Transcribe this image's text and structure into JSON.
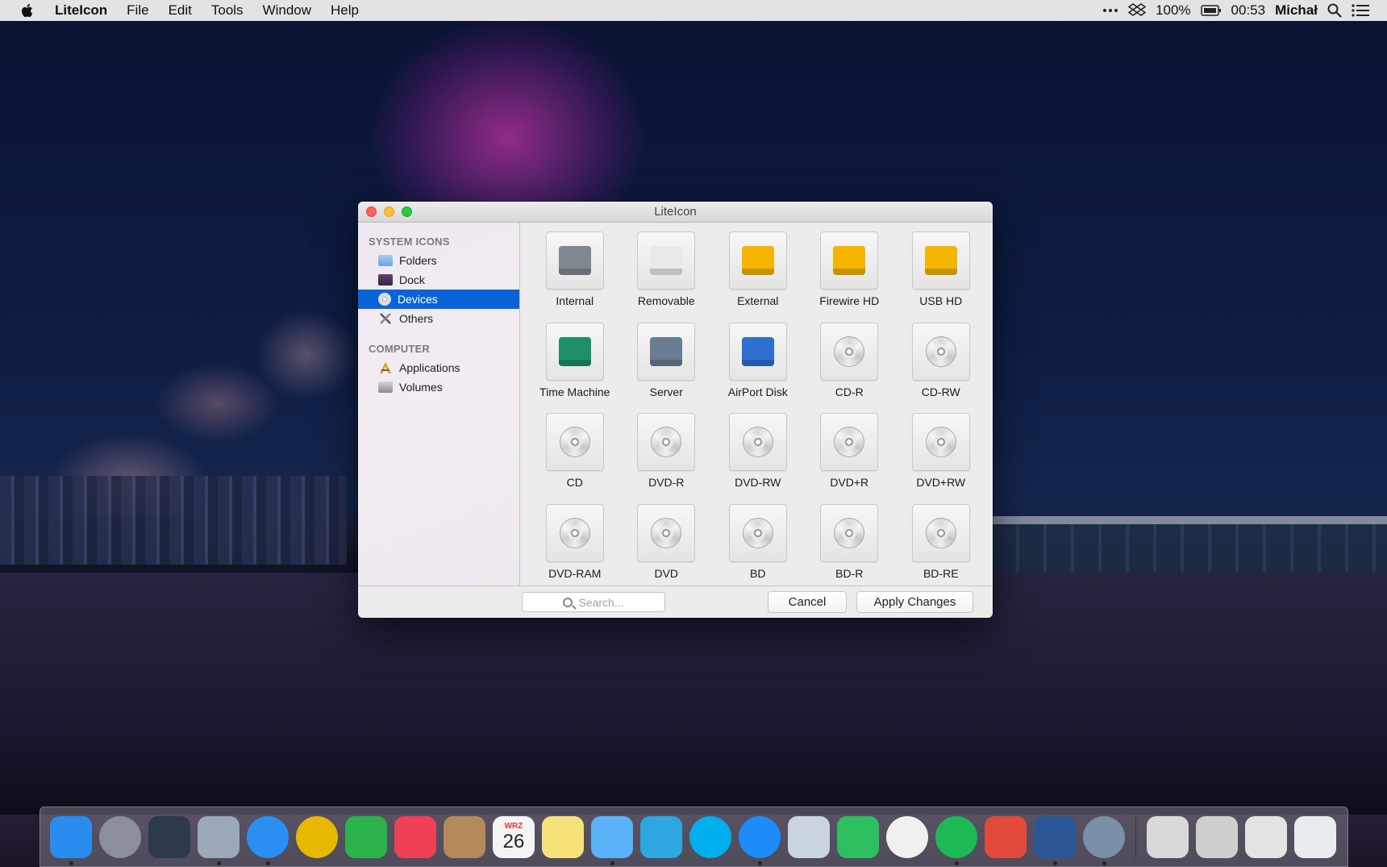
{
  "menubar": {
    "app_name": "LiteIcon",
    "menus": [
      "File",
      "Edit",
      "Tools",
      "Window",
      "Help"
    ],
    "battery": "100%",
    "clock": "00:53",
    "user": "Michał",
    "icons": [
      "apple-icon",
      "more-icon",
      "dropbox-icon",
      "battery-icon",
      "spotlight-icon",
      "notification-center-icon"
    ]
  },
  "window": {
    "title": "LiteIcon",
    "sidebar": {
      "sections": [
        {
          "header": "SYSTEM ICONS",
          "items": [
            {
              "label": "Folders",
              "icon": "folder-icon"
            },
            {
              "label": "Dock",
              "icon": "dock-icon"
            },
            {
              "label": "Devices",
              "icon": "disc-icon",
              "selected": true
            },
            {
              "label": "Others",
              "icon": "tools-icon"
            }
          ]
        },
        {
          "header": "COMPUTER",
          "items": [
            {
              "label": "Applications",
              "icon": "applications-icon"
            },
            {
              "label": "Volumes",
              "icon": "volume-icon"
            }
          ]
        }
      ]
    },
    "devices": [
      {
        "label": "Internal",
        "kind": "drive",
        "color": "#7f8790"
      },
      {
        "label": "Removable",
        "kind": "drive",
        "color": "#e9e9e9"
      },
      {
        "label": "External",
        "kind": "drive",
        "color": "#f5b400"
      },
      {
        "label": "Firewire HD",
        "kind": "drive",
        "color": "#f5b400"
      },
      {
        "label": "USB HD",
        "kind": "drive",
        "color": "#f5b400"
      },
      {
        "label": "Time Machine",
        "kind": "drive",
        "color": "#1f8f6a"
      },
      {
        "label": "Server",
        "kind": "drive",
        "color": "#6a7c92"
      },
      {
        "label": "AirPort Disk",
        "kind": "drive",
        "color": "#2f6fd0"
      },
      {
        "label": "CD-R",
        "kind": "disc"
      },
      {
        "label": "CD-RW",
        "kind": "disc"
      },
      {
        "label": "CD",
        "kind": "disc"
      },
      {
        "label": "DVD-R",
        "kind": "disc"
      },
      {
        "label": "DVD-RW",
        "kind": "disc"
      },
      {
        "label": "DVD+R",
        "kind": "disc"
      },
      {
        "label": "DVD+RW",
        "kind": "disc"
      },
      {
        "label": "DVD-RAM",
        "kind": "disc"
      },
      {
        "label": "DVD",
        "kind": "disc"
      },
      {
        "label": "BD",
        "kind": "disc"
      },
      {
        "label": "BD-R",
        "kind": "disc"
      },
      {
        "label": "BD-RE",
        "kind": "disc"
      }
    ],
    "search_placeholder": "Search...",
    "cancel_label": "Cancel",
    "apply_label": "Apply Changes"
  },
  "dock": {
    "calendar_month": "WRZ",
    "calendar_day": "26",
    "items": [
      {
        "name": "finder-icon",
        "color": "#2b8cf0",
        "running": true
      },
      {
        "name": "launchpad-icon",
        "color": "#8a8f99",
        "running": false
      },
      {
        "name": "mission-control-icon",
        "color": "#2c3a4a",
        "running": false
      },
      {
        "name": "mail-icon",
        "color": "#9aa8b8",
        "running": true
      },
      {
        "name": "safari-icon",
        "color": "#2a8ff0",
        "running": true
      },
      {
        "name": "chrome-icon",
        "color": "#e8b800",
        "running": false
      },
      {
        "name": "feedly-icon",
        "color": "#2bb24c",
        "running": false
      },
      {
        "name": "pocket-icon",
        "color": "#ef4056",
        "running": false
      },
      {
        "name": "contacts-icon",
        "color": "#b48a5a",
        "running": false
      },
      {
        "name": "calendar-icon",
        "color": "#f4f4f4",
        "running": false
      },
      {
        "name": "notes-icon",
        "color": "#f7e27a",
        "running": false
      },
      {
        "name": "messages-icon",
        "color": "#5ab2f7",
        "running": true
      },
      {
        "name": "telegram-icon",
        "color": "#2ea6e0",
        "running": false
      },
      {
        "name": "skype-icon",
        "color": "#00aff0",
        "running": false
      },
      {
        "name": "messenger-icon",
        "color": "#1d8cf8",
        "running": true
      },
      {
        "name": "preview-icon",
        "color": "#c9d4e0",
        "running": false
      },
      {
        "name": "evernote-icon",
        "color": "#2dbe60",
        "running": false
      },
      {
        "name": "itunes-icon",
        "color": "#f0f0f0",
        "running": false
      },
      {
        "name": "spotify-icon",
        "color": "#1db954",
        "running": true
      },
      {
        "name": "transmit-icon",
        "color": "#e24a3b",
        "running": false
      },
      {
        "name": "word-icon",
        "color": "#2b5797",
        "running": true
      },
      {
        "name": "liteicon-icon",
        "color": "#7a8fa8",
        "running": true
      },
      {
        "name": "downloads-stack-icon",
        "color": "#d9d9d9",
        "running": false
      },
      {
        "name": "photos-stack-icon",
        "color": "#cfcfcf",
        "running": false
      },
      {
        "name": "documents-stack-icon",
        "color": "#e4e4e4",
        "running": false
      },
      {
        "name": "trash-icon",
        "color": "#e9ecef",
        "running": false
      }
    ]
  }
}
